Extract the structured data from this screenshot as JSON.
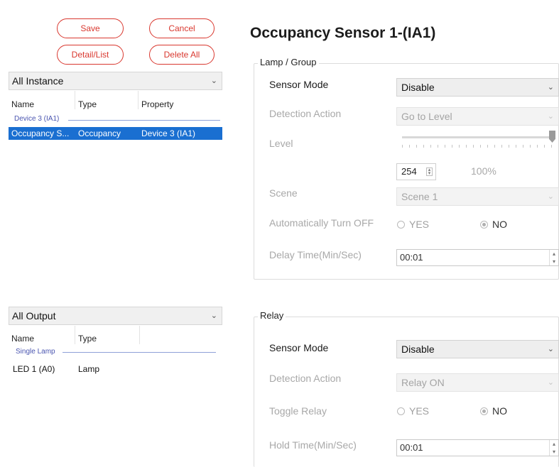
{
  "left_panel": {
    "buttons": {
      "save": "Save",
      "cancel": "Cancel",
      "detail_list": "Detail/List",
      "delete_all": "Delete All"
    },
    "instance_combo": {
      "selected": "All Instance"
    },
    "instance_table": {
      "columns": [
        "Name",
        "Type",
        "Property"
      ],
      "group": "Device 3 (IA1)",
      "rows": [
        {
          "name": "Occupancy S...",
          "type": "Occupancy",
          "property": "Device 3 (IA1)",
          "selected": true
        }
      ]
    },
    "output_combo": {
      "selected": "All Output"
    },
    "output_table": {
      "columns": [
        "Name",
        "Type"
      ],
      "group": "Single Lamp",
      "rows": [
        {
          "name": "LED 1 (A0)",
          "type": "Lamp"
        }
      ]
    }
  },
  "right_panel": {
    "title": "Occupancy Sensor 1-(IA1)",
    "lamp_group": {
      "legend": "Lamp / Group",
      "sensor_mode_label": "Sensor Mode",
      "sensor_mode_value": "Disable",
      "detection_action_label": "Detection Action",
      "detection_action_value": "Go to Level",
      "level_label": "Level",
      "level_value": "254",
      "level_percent": "100%",
      "level_fraction": 1.0,
      "scene_label": "Scene",
      "scene_value": "Scene 1",
      "auto_off_label": "Automatically Turn OFF",
      "yes_label": "YES",
      "no_label": "NO",
      "auto_off_selected": "NO",
      "delay_label": "Delay Time(Min/Sec)",
      "delay_value": "00:01"
    },
    "relay": {
      "legend": "Relay",
      "sensor_mode_label": "Sensor Mode",
      "sensor_mode_value": "Disable",
      "detection_action_label": "Detection Action",
      "detection_action_value": "Relay ON",
      "toggle_label": "Toggle Relay",
      "yes_label": "YES",
      "no_label": "NO",
      "toggle_selected": "NO",
      "hold_label": "Hold Time(Min/Sec)",
      "hold_value": "00:01"
    }
  },
  "colors": {
    "accent_red": "#d9382f",
    "selection_blue": "#1a6fd1",
    "group_blue": "#4a55b0"
  }
}
